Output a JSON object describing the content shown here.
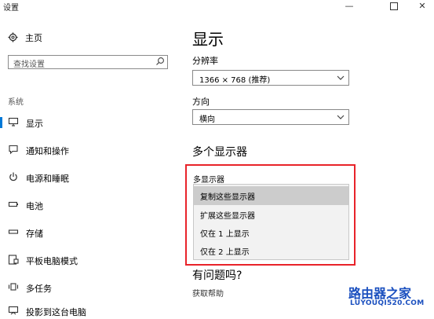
{
  "window": {
    "title": "设置",
    "minimize": "—",
    "close": "✕"
  },
  "sidebar": {
    "home_label": "主页",
    "search_placeholder": "查找设置",
    "section_label": "系统",
    "items": [
      {
        "label": "显示",
        "icon": "monitor-icon"
      },
      {
        "label": "通知和操作",
        "icon": "message-icon"
      },
      {
        "label": "电源和睡眠",
        "icon": "power-icon"
      },
      {
        "label": "电池",
        "icon": "battery-icon"
      },
      {
        "label": "存储",
        "icon": "storage-icon"
      },
      {
        "label": "平板电脑模式",
        "icon": "tablet-icon"
      },
      {
        "label": "多任务",
        "icon": "multitask-icon"
      },
      {
        "label": "投影到这台电脑",
        "icon": "project-icon"
      }
    ]
  },
  "main": {
    "title": "显示",
    "resolution": {
      "label": "分辨率",
      "value": "1366 × 768 (推荐)"
    },
    "orientation": {
      "label": "方向",
      "value": "横向"
    },
    "multi_display": {
      "section_title": "多个显示器",
      "label": "多显示器",
      "options": [
        "复制这些显示器",
        "扩展这些显示器",
        "仅在 1 上显示",
        "仅在 2 上显示"
      ],
      "selected_index": 0
    },
    "help": {
      "title": "有问题吗?",
      "link": "获取帮助"
    }
  },
  "watermark": {
    "text": "路由器之家",
    "url": "LUYOUQI520.COM"
  },
  "colors": {
    "accent": "#0078d7",
    "highlight_border": "#e8232a",
    "selected_option": "#cccccc"
  }
}
